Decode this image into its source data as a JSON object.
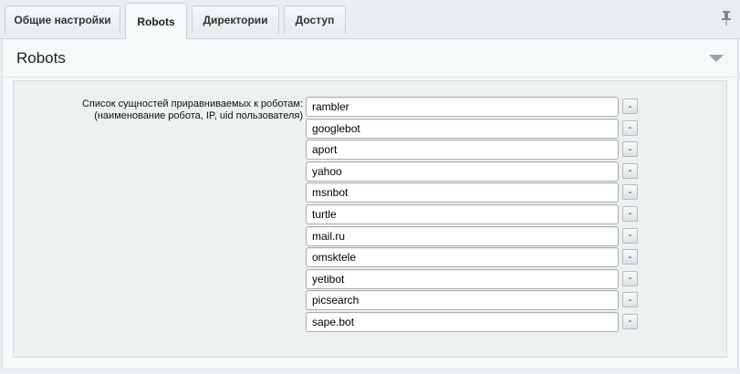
{
  "tabs": [
    {
      "label": "Общие настройки",
      "active": false
    },
    {
      "label": "Robots",
      "active": true
    },
    {
      "label": "Директории",
      "active": false
    },
    {
      "label": "Доступ",
      "active": false
    }
  ],
  "panel": {
    "title": "Robots",
    "field_label_line1": "Список сущностей приравниваемых к роботам:",
    "field_label_line2": "(наименование робота, IP, uid пользователя)",
    "remove_label": "-",
    "robots": [
      "rambler",
      "googlebot",
      "aport",
      "yahoo",
      "msnbot",
      "turtle",
      "mail.ru",
      "omsktele",
      "yetibot",
      "picsearch",
      "sape.bot"
    ]
  },
  "icons": {
    "pin": "pin-icon",
    "collapse": "collapse-arrow-icon"
  }
}
